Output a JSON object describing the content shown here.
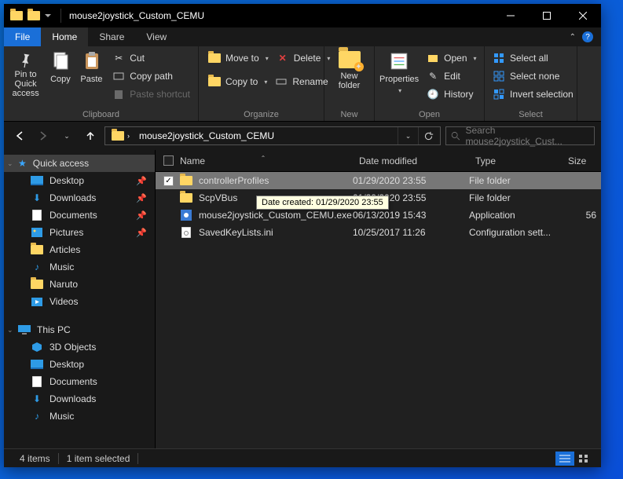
{
  "title": "mouse2joystick_Custom_CEMU",
  "tabs": {
    "file": "File",
    "home": "Home",
    "share": "Share",
    "view": "View"
  },
  "ribbon": {
    "clipboard": {
      "label": "Clipboard",
      "pin": "Pin to Quick access",
      "copy": "Copy",
      "paste": "Paste",
      "cut": "Cut",
      "copypath": "Copy path",
      "pasteshortcut": "Paste shortcut"
    },
    "organize": {
      "label": "Organize",
      "moveto": "Move to",
      "copyto": "Copy to",
      "delete": "Delete",
      "rename": "Rename"
    },
    "new": {
      "label": "New",
      "newfolder": "New folder"
    },
    "open": {
      "label": "Open",
      "properties": "Properties",
      "open": "Open",
      "edit": "Edit",
      "history": "History"
    },
    "select": {
      "label": "Select",
      "all": "Select all",
      "none": "Select none",
      "invert": "Invert selection"
    }
  },
  "address": {
    "path": "mouse2joystick_Custom_CEMU",
    "search_placeholder": "Search mouse2joystick_Cust..."
  },
  "nav": {
    "quickaccess": "Quick access",
    "desktop": "Desktop",
    "downloads": "Downloads",
    "documents": "Documents",
    "pictures": "Pictures",
    "articles": "Articles",
    "music": "Music",
    "naruto": "Naruto",
    "videos": "Videos",
    "thispc": "This PC",
    "objects3d": "3D Objects",
    "desktop2": "Desktop",
    "documents2": "Documents",
    "downloads2": "Downloads",
    "music2": "Music"
  },
  "columns": {
    "name": "Name",
    "date": "Date modified",
    "type": "Type",
    "size": "Size"
  },
  "files": [
    {
      "name": "controllerProfiles",
      "date": "01/29/2020 23:55",
      "type": "File folder",
      "size": "",
      "kind": "folder",
      "selected": true
    },
    {
      "name": "ScpVBus",
      "date": "01/29/2020 23:55",
      "type": "File folder",
      "size": "",
      "kind": "folder"
    },
    {
      "name": "mouse2joystick_Custom_CEMU.exe",
      "date": "06/13/2019 15:43",
      "type": "Application",
      "size": "56",
      "kind": "exe"
    },
    {
      "name": "SavedKeyLists.ini",
      "date": "10/25/2017 11:26",
      "type": "Configuration sett...",
      "size": "",
      "kind": "ini"
    }
  ],
  "tooltip": "Date created: 01/29/2020 23:55",
  "status": {
    "count": "4 items",
    "selected": "1 item selected"
  }
}
